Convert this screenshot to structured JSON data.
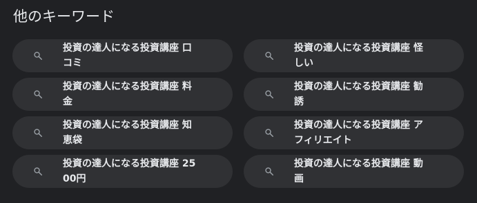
{
  "section": {
    "title": "他のキーワード"
  },
  "colors": {
    "background": "#202124",
    "chip": "#303134",
    "text": "#e8eaed",
    "icon": "#9aa0a6"
  },
  "keywords": [
    {
      "label": "投資の達人になる投資講座 口コミ",
      "icon": "search-icon"
    },
    {
      "label": "投資の達人になる投資講座 怪しい",
      "icon": "search-icon"
    },
    {
      "label": "投資の達人になる投資講座 料金",
      "icon": "search-icon"
    },
    {
      "label": "投資の達人になる投資講座 勧誘",
      "icon": "search-icon"
    },
    {
      "label": "投資の達人になる投資講座 知恵袋",
      "icon": "search-icon"
    },
    {
      "label": "投資の達人になる投資講座 アフィリエイト",
      "icon": "search-icon"
    },
    {
      "label": "投資の達人になる投資講座 2500円",
      "icon": "search-icon"
    },
    {
      "label": "投資の達人になる投資講座 動画",
      "icon": "search-icon"
    }
  ]
}
